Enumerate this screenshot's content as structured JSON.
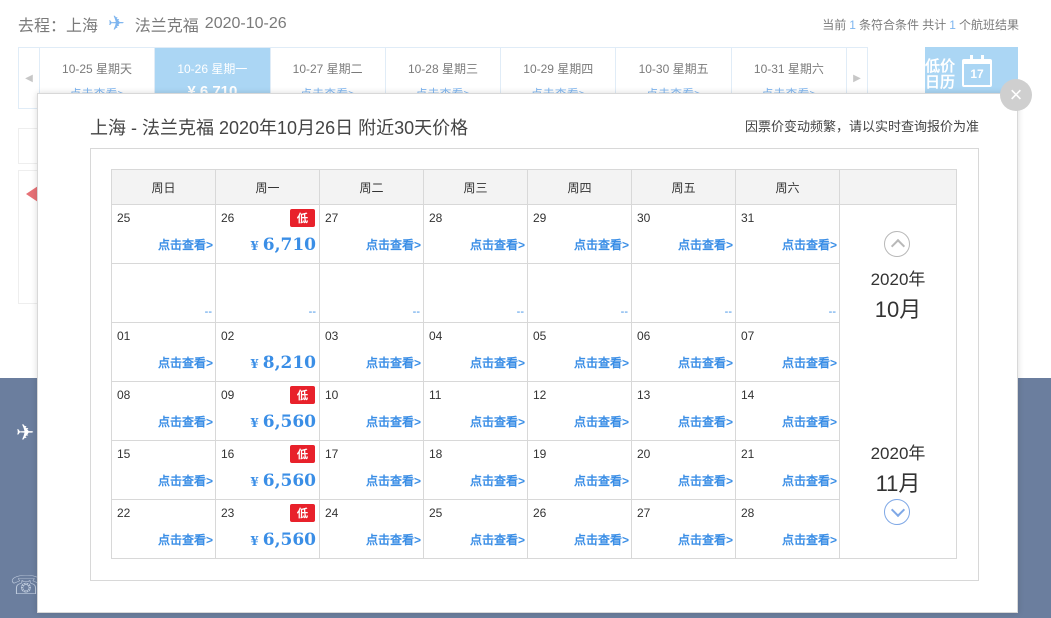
{
  "header": {
    "route_label": "去程：上海",
    "destination": "法兰克福",
    "date": "2020-10-26",
    "summary_prefix": "当前",
    "summary_count": "1",
    "summary_mid": "条符合条件 共计",
    "summary_total": "1",
    "summary_suffix": "个航班结果"
  },
  "datebar": {
    "days": [
      {
        "label": "10-25 星期天",
        "sub": "点击查看>"
      },
      {
        "label": "10-26 星期一",
        "sub": "¥ 6,710"
      },
      {
        "label": "10-27 星期二",
        "sub": "点击查看>"
      },
      {
        "label": "10-28 星期三",
        "sub": "点击查看>"
      },
      {
        "label": "10-29 星期四",
        "sub": "点击查看>"
      },
      {
        "label": "10-30 星期五",
        "sub": "点击查看>"
      },
      {
        "label": "10-31 星期六",
        "sub": "点击查看>"
      }
    ],
    "calendar_button": {
      "line1": "低价",
      "line2": "日历",
      "day": "17"
    }
  },
  "modal": {
    "title": "上海 - 法兰克福 2020年10月26日  附近30天价格",
    "note": "因票价变动频繁，请以实时查询报价为准",
    "weekdays": [
      "周日",
      "周一",
      "周二",
      "周三",
      "周四",
      "周五",
      "周六"
    ],
    "view_label": "点击查看>",
    "low_label": "低",
    "currency": "¥",
    "dash": "--",
    "rows": [
      [
        {
          "d": "25"
        },
        {
          "d": "26",
          "low": true,
          "price": "6,710"
        },
        {
          "d": "27"
        },
        {
          "d": "28"
        },
        {
          "d": "29"
        },
        {
          "d": "30"
        },
        {
          "d": "31"
        }
      ],
      [
        {
          "empty": true
        },
        {
          "empty": true
        },
        {
          "empty": true
        },
        {
          "empty": true
        },
        {
          "empty": true
        },
        {
          "empty": true
        },
        {
          "empty": true
        }
      ],
      [
        {
          "d": "01"
        },
        {
          "d": "02",
          "price": "8,210"
        },
        {
          "d": "03"
        },
        {
          "d": "04"
        },
        {
          "d": "05"
        },
        {
          "d": "06"
        },
        {
          "d": "07"
        }
      ],
      [
        {
          "d": "08"
        },
        {
          "d": "09",
          "low": true,
          "price": "6,560"
        },
        {
          "d": "10"
        },
        {
          "d": "11"
        },
        {
          "d": "12"
        },
        {
          "d": "13"
        },
        {
          "d": "14"
        }
      ],
      [
        {
          "d": "15"
        },
        {
          "d": "16",
          "low": true,
          "price": "6,560"
        },
        {
          "d": "17"
        },
        {
          "d": "18"
        },
        {
          "d": "19"
        },
        {
          "d": "20"
        },
        {
          "d": "21"
        }
      ],
      [
        {
          "d": "22"
        },
        {
          "d": "23",
          "low": true,
          "price": "6,560"
        },
        {
          "d": "24"
        },
        {
          "d": "25"
        },
        {
          "d": "26"
        },
        {
          "d": "27"
        },
        {
          "d": "28"
        }
      ]
    ],
    "month1": {
      "year": "2020年",
      "month": "10月"
    },
    "month2": {
      "year": "2020年",
      "month": "11月"
    },
    "close_icon": "×"
  }
}
